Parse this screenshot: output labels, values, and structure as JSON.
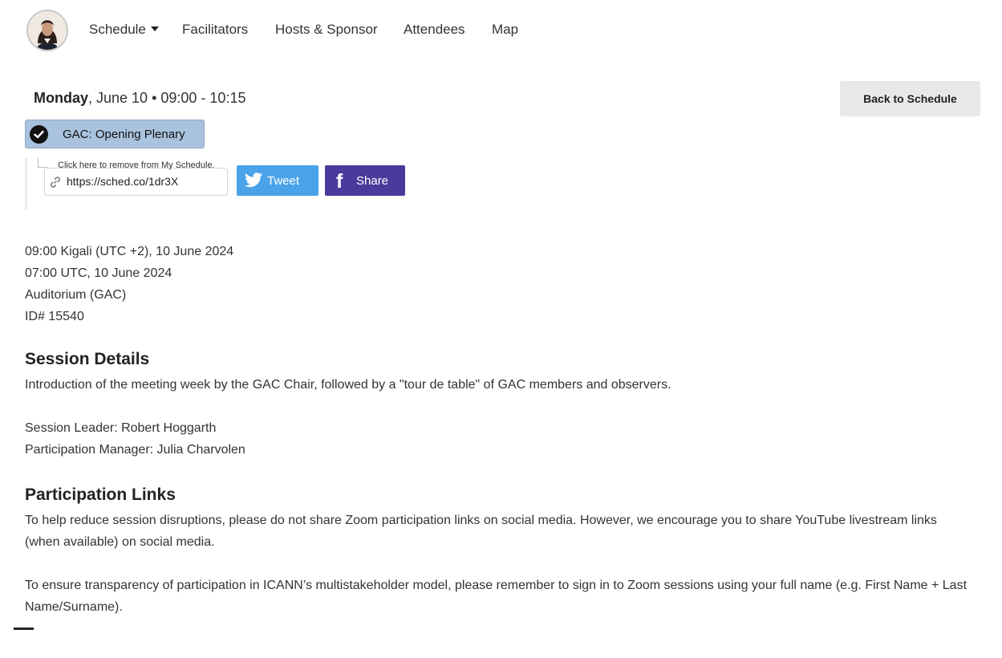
{
  "nav": {
    "items": [
      "Schedule",
      "Facilitators",
      "Hosts & Sponsor",
      "Attendees",
      "Map"
    ]
  },
  "session": {
    "day": "Monday",
    "date_rest": ", June 10 • 09:00 - 10:15",
    "title": "GAC: Opening Plenary",
    "back_label": "Back to Schedule",
    "tooltip": "Click here to remove from My Schedule.",
    "short_url": "https://sched.co/1dr3X",
    "tweet_label": "Tweet",
    "share_label": "Share"
  },
  "info": {
    "local_time": "09:00 Kigali (UTC +2), 10 June 2024",
    "utc_time": "07:00 UTC, 10 June 2024",
    "room": "Auditorium (GAC)",
    "id": "ID# 15540"
  },
  "details": {
    "heading": "Session Details",
    "description": "Introduction of the meeting week by the GAC Chair, followed by a \"tour de table\" of GAC members and observers.",
    "leader": "Session Leader: Robert Hoggarth",
    "manager": "Participation Manager: Julia Charvolen"
  },
  "links": {
    "heading": "Participation Links",
    "p1": "To help reduce session disruptions, please do not share Zoom participation links on social media. However, we encourage you to share YouTube livestream links (when available) on social media.",
    "p2": "To ensure transparency of participation in ICANN’s multistakeholder model, please remember to sign in to Zoom sessions using your full name (e.g. First Name + Last Name/Surname)."
  },
  "colors": {
    "pill_bg": "#a9c3de",
    "twitter": "#4aa3e9",
    "facebook": "#4b3a9c",
    "back_btn": "#e8e8e8"
  }
}
